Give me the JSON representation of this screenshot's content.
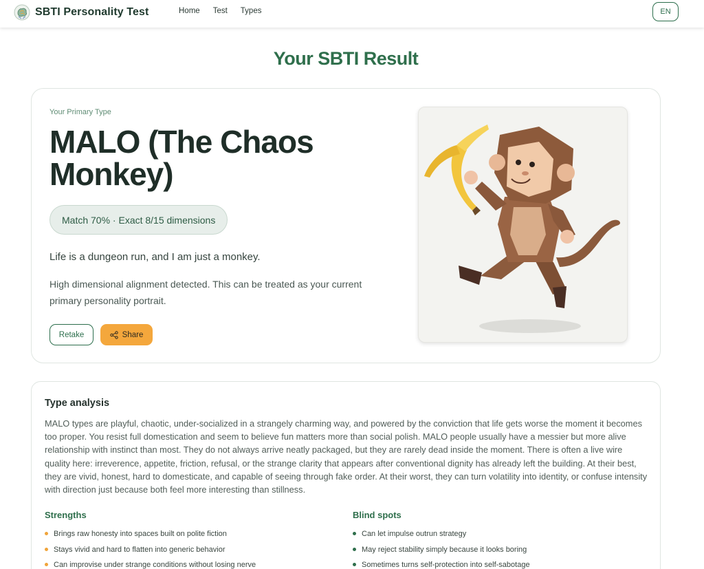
{
  "header": {
    "brand": "SBTI Personality Test",
    "nav": [
      "Home",
      "Test",
      "Types"
    ],
    "lang": "EN"
  },
  "page_title": "Your SBTI Result",
  "result": {
    "eyebrow": "Your Primary Type",
    "type_name": "MALO (The Chaos Monkey)",
    "match": "Match 70% · Exact 8/15 dimensions",
    "tagline": "Life is a dungeon run, and I am just a monkey.",
    "description": "High dimensional alignment detected. This can be treated as your current primary personality portrait.",
    "retake_label": "Retake",
    "share_label": "Share",
    "illustration": "low-poly-monkey-holding-banana"
  },
  "analysis": {
    "title": "Type analysis",
    "text": "MALO types are playful, chaotic, under-socialized in a strangely charming way, and powered by the conviction that life gets worse the moment it becomes too proper. You resist full domestication and seem to believe fun matters more than social polish. MALO people usually have a messier but more alive relationship with instinct than most. They do not always arrive neatly packaged, but they are rarely dead inside the moment. There is often a live wire quality here: irreverence, appetite, friction, refusal, or the strange clarity that appears after conventional dignity has already left the building. At their best, they are vivid, honest, hard to domesticate, and capable of seeing through fake order. At their worst, they can turn volatility into identity, or confuse intensity with direction just because both feel more interesting than stillness.",
    "strengths_title": "Strengths",
    "strengths": [
      "Brings raw honesty into spaces built on polite fiction",
      "Stays vivid and hard to flatten into generic behavior",
      "Can improvise under strange conditions without losing nerve"
    ],
    "blindspots_title": "Blind spots",
    "blindspots": [
      "Can let impulse outrun strategy",
      "May reject stability simply because it looks boring",
      "Sometimes turns self-protection into self-sabotage"
    ]
  },
  "colors": {
    "brand_green": "#2f6f4c",
    "accent_orange": "#f4a73c",
    "pill_bg": "#e7eeea"
  }
}
